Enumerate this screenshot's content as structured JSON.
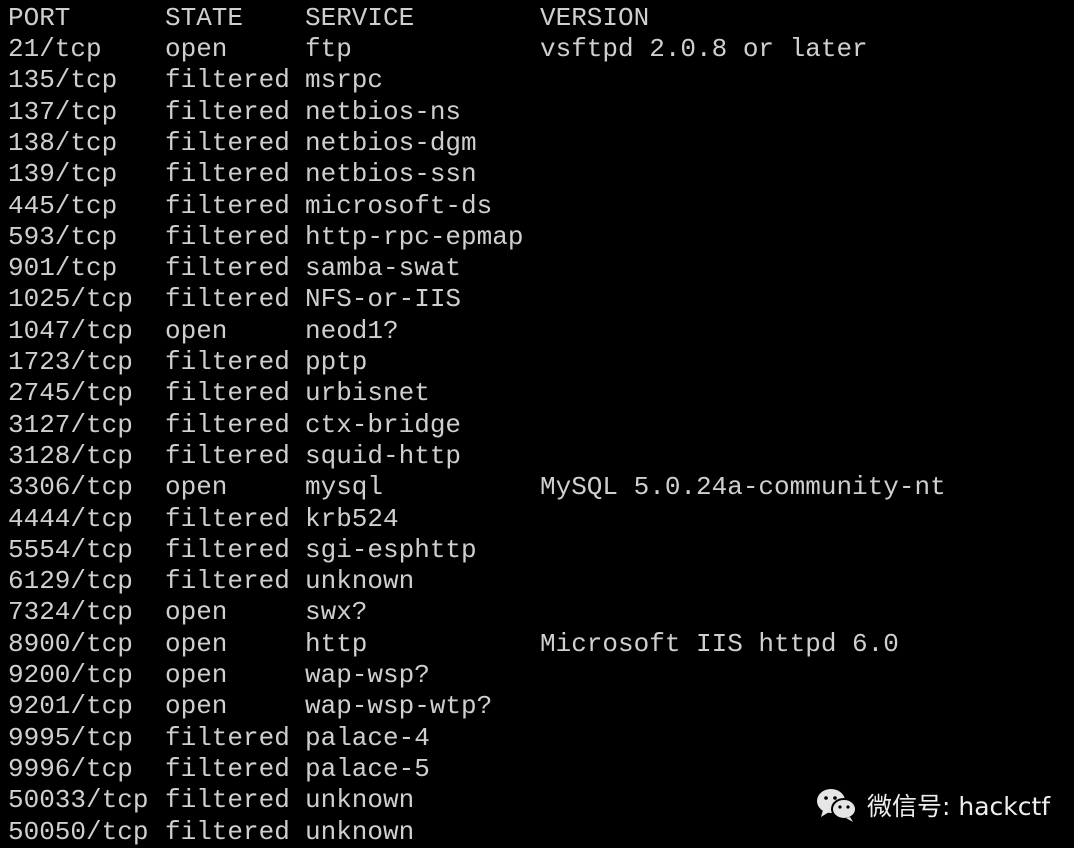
{
  "header": {
    "port": "PORT",
    "state": "STATE",
    "service": "SERVICE",
    "version": "VERSION"
  },
  "rows": [
    [
      "21/tcp",
      "open",
      "ftp",
      "vsftpd 2.0.8 or later"
    ],
    [
      "135/tcp",
      "filtered",
      "msrpc",
      ""
    ],
    [
      "137/tcp",
      "filtered",
      "netbios-ns",
      ""
    ],
    [
      "138/tcp",
      "filtered",
      "netbios-dgm",
      ""
    ],
    [
      "139/tcp",
      "filtered",
      "netbios-ssn",
      ""
    ],
    [
      "445/tcp",
      "filtered",
      "microsoft-ds",
      ""
    ],
    [
      "593/tcp",
      "filtered",
      "http-rpc-epmap",
      ""
    ],
    [
      "901/tcp",
      "filtered",
      "samba-swat",
      ""
    ],
    [
      "1025/tcp",
      "filtered",
      "NFS-or-IIS",
      ""
    ],
    [
      "1047/tcp",
      "open",
      "neod1?",
      ""
    ],
    [
      "1723/tcp",
      "filtered",
      "pptp",
      ""
    ],
    [
      "2745/tcp",
      "filtered",
      "urbisnet",
      ""
    ],
    [
      "3127/tcp",
      "filtered",
      "ctx-bridge",
      ""
    ],
    [
      "3128/tcp",
      "filtered",
      "squid-http",
      ""
    ],
    [
      "3306/tcp",
      "open",
      "mysql",
      "MySQL 5.0.24a-community-nt"
    ],
    [
      "4444/tcp",
      "filtered",
      "krb524",
      ""
    ],
    [
      "5554/tcp",
      "filtered",
      "sgi-esphttp",
      ""
    ],
    [
      "6129/tcp",
      "filtered",
      "unknown",
      ""
    ],
    [
      "7324/tcp",
      "open",
      "swx?",
      ""
    ],
    [
      "8900/tcp",
      "open",
      "http",
      "Microsoft IIS httpd 6.0"
    ],
    [
      "9200/tcp",
      "open",
      "wap-wsp?",
      ""
    ],
    [
      "9201/tcp",
      "open",
      "wap-wsp-wtp?",
      ""
    ],
    [
      "9995/tcp",
      "filtered",
      "palace-4",
      ""
    ],
    [
      "9996/tcp",
      "filtered",
      "palace-5",
      ""
    ],
    [
      "50033/tcp",
      "filtered",
      "unknown",
      ""
    ],
    [
      "50050/tcp",
      "filtered",
      "unknown",
      ""
    ]
  ],
  "watermark": {
    "text": "微信号: hackctf",
    "icon": "wechat-icon"
  }
}
